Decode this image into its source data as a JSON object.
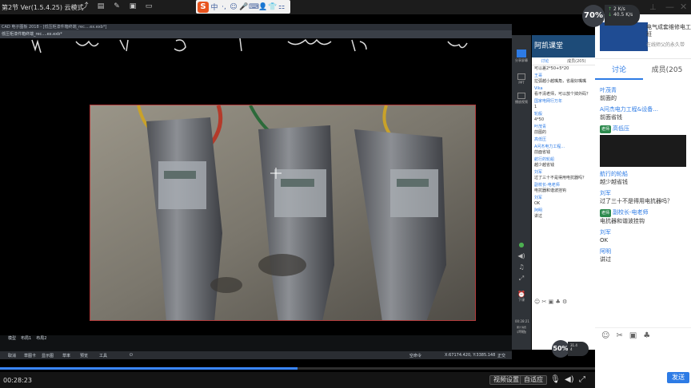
{
  "topbar": {
    "title": "第2节 Ver(1.5.4.25) 云模式",
    "icons": [
      "share-icon",
      "note-icon",
      "edit-icon",
      "image-icon",
      "folder-icon"
    ]
  },
  "ime": {
    "logo": "S",
    "chars": [
      "中",
      "·,",
      "☺",
      "🎤",
      "⌨",
      "👤",
      "👕",
      "⚏"
    ]
  },
  "speed_widget": {
    "percent": "70%",
    "up": "2",
    "down": "40.5",
    "unit": "K/s"
  },
  "cad": {
    "title": "CAD 电子图板 2018 - [低压柜漆件箱终端_rec....ex.exb*]",
    "tab": "低压柜漆件箱终端_rec....ex.exb*",
    "layout_tabs": [
      "模型",
      "布局1",
      "布局2"
    ],
    "cmd_items": [
      "取消",
      "草图卡",
      "显示图",
      "草率",
      "预览",
      "工具"
    ],
    "coords": "X:67174.420, Y:3385.148",
    "status": [
      "空命令",
      "正交"
    ]
  },
  "inner_side": {
    "labels": [
      "分享屏幕",
      "PPT",
      "播放视频",
      "下课"
    ],
    "time": "00:28:21",
    "net": "累计消费 1024",
    "net2": "平均电量"
  },
  "inner_chat": {
    "header": "阿凯课堂",
    "tabs": [
      "讨论",
      "成员(205)"
    ],
    "messages": [
      {
        "name": "",
        "text": "可以差2*50+5*20"
      },
      {
        "name": "王哥",
        "text": "拉弧越小越嘴角，省最好嘴嘴"
      },
      {
        "name": "Vika",
        "text": "看不清老师，可以放个掉外码？"
      },
      {
        "name": "国家电网行万年",
        "text": "1"
      },
      {
        "name": "轮般",
        "text": "4*50"
      },
      {
        "name": "叶茂青",
        "text": "前图的"
      },
      {
        "name": "高低压",
        "text": ""
      },
      {
        "name": "A问杰电力工程...",
        "text": "前面省钱"
      },
      {
        "name": "航行的轮船",
        "text": "越少越省钱"
      },
      {
        "name": "刘军",
        "text": "过了三十不是得用电抗器吗？"
      },
      {
        "name": "副校长-电老师",
        "text": "电抗器和谐波挂钩"
      },
      {
        "name": "刘军",
        "text": "OK"
      },
      {
        "name": "阿明",
        "text": "讲过"
      }
    ]
  },
  "right_panel": {
    "header_title": "电气成套维修电工班",
    "header_sub": "在线师父的永久带",
    "tabs": [
      "讨论",
      "成员(205"
    ],
    "messages": [
      {
        "tag": "",
        "name": "叶茂青",
        "text": "前面的"
      },
      {
        "tag": "",
        "name": "A问杰电力工程&设备...",
        "text": "前面省钱"
      },
      {
        "tag": "老师",
        "name": "高低压",
        "text": "",
        "image": true
      },
      {
        "tag": "",
        "name": "航行的轮船",
        "text": "越少越省钱"
      },
      {
        "tag": "",
        "name": "刘军",
        "text": "过了三十不是得用电抗器吗？"
      },
      {
        "tag": "老师",
        "name": "副校长-电老师",
        "text": "电抗器和谐波挂钩"
      },
      {
        "tag": "",
        "name": "刘军",
        "text": "OK"
      },
      {
        "tag": "",
        "name": "阿明",
        "text": "讲过"
      }
    ],
    "send_label": "发送"
  },
  "player": {
    "time": "00:28:23",
    "progress_fraction": 0.5,
    "buttons": [
      "视频设置",
      "自适应"
    ],
    "gauge_small": "50%",
    "gauge_small_up": "31.4",
    "gauge_small_down": "4"
  },
  "colors": {
    "accent": "#2d7be5",
    "teacher_tag": "#2d8a4e",
    "photo_border": "#b23a3a"
  }
}
